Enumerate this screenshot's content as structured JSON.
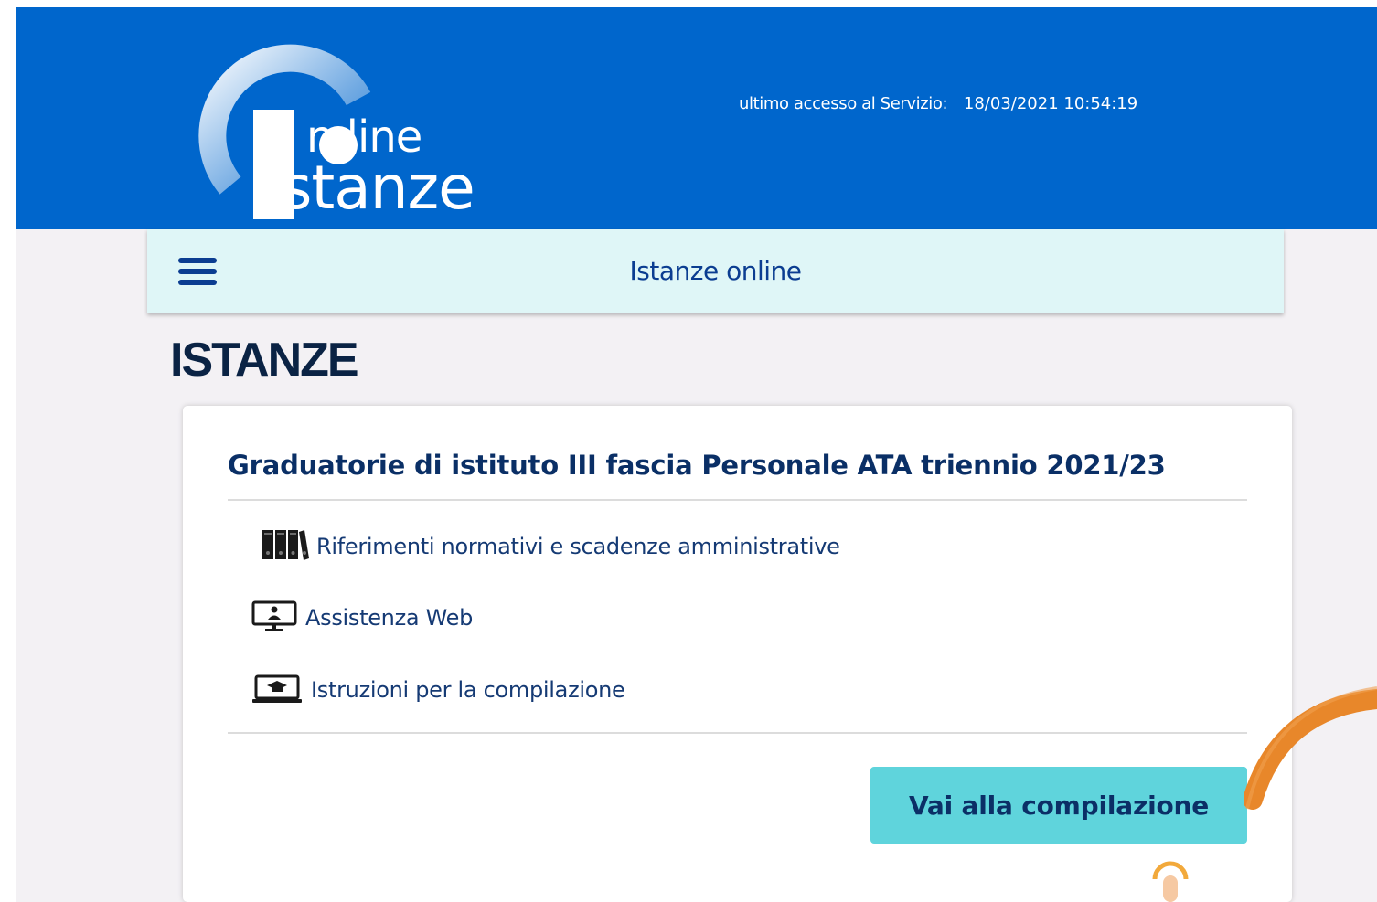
{
  "header": {
    "logo": {
      "line1": "n line",
      "line2": "stanze"
    },
    "last_access_label": "ultimo accesso al Servizio:",
    "last_access_value": "18/03/2021 10:54:19"
  },
  "navbar": {
    "title": "Istanze online"
  },
  "page": {
    "title": "ISTANZE"
  },
  "card": {
    "title": "Graduatorie di istituto III fascia Personale ATA triennio 2021/23",
    "links": [
      {
        "label": "Riferimenti normativi e scadenze amministrative",
        "icon": "binders-icon"
      },
      {
        "label": "Assistenza Web",
        "icon": "monitor-user-icon"
      },
      {
        "label": "Istruzioni per la compilazione",
        "icon": "laptop-graduation-icon"
      }
    ],
    "action_label": "Vai alla compilazione"
  },
  "colors": {
    "header_bg": "#0066cc",
    "navbar_bg": "#dff6f7",
    "button_bg": "#5fd4dc",
    "text_dark_blue": "#0a2f66",
    "accent_orange": "#e8872a"
  }
}
